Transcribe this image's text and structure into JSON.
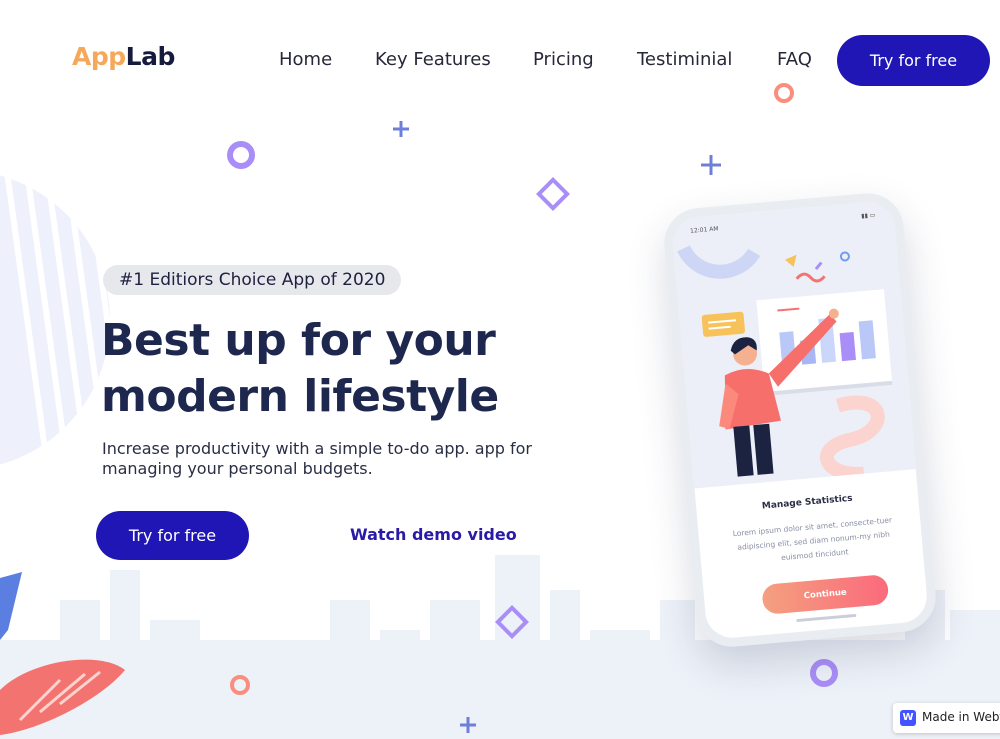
{
  "brand": {
    "logo_part1": "App",
    "logo_part2": "Lab",
    "accent_color": "#f6a85a",
    "primary_color": "#1f16b5"
  },
  "nav": {
    "links": [
      "Home",
      "Key Features",
      "Pricing",
      "Testiminial",
      "FAQ"
    ],
    "cta_label": "Try for free"
  },
  "hero": {
    "badge": "#1 Editiors Choice App of 2020",
    "title": "Best up for your modern lifestyle",
    "subtitle": "Increase productivity with a simple to-do app. app for managing your personal budgets.",
    "cta_label": "Try for free",
    "demo_label": "Watch demo video"
  },
  "phone": {
    "card_title": "Manage Statistics",
    "card_text": "Lorem ipsum dolor sit amet, consecte-tuer adipiscing elit, sed diam nonum-my nibh euismod tincidunt",
    "button_label": "Continue",
    "status_time": "12:01 AM"
  },
  "badge_footer": {
    "label": "Made in Webflow",
    "icon": "webflow-icon"
  }
}
